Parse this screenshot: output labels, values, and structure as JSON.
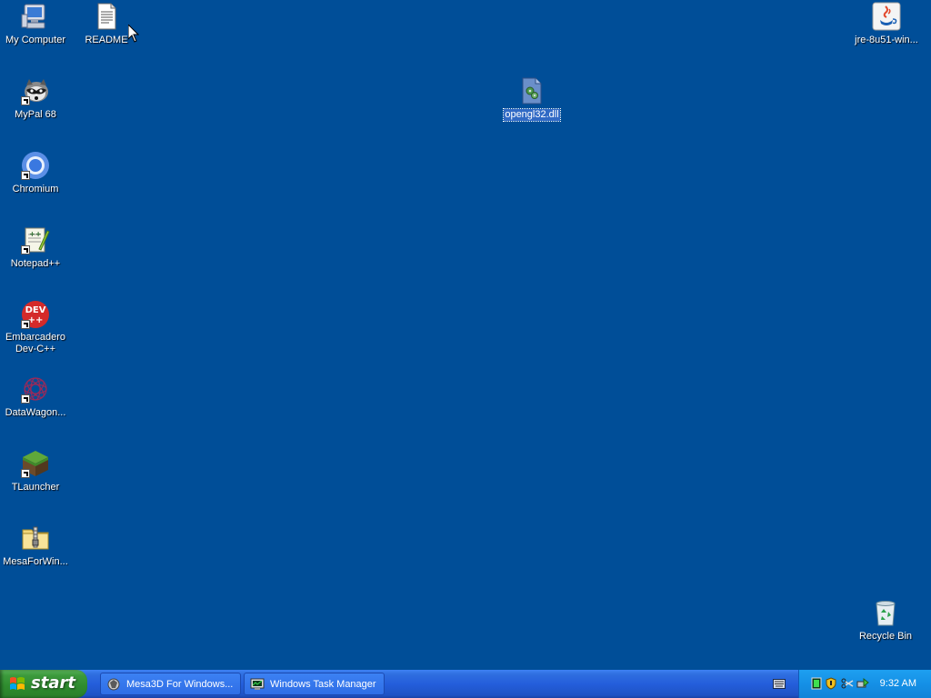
{
  "desktop": {
    "background": "#004e98",
    "icons": {
      "my_computer": "My Computer",
      "readme": "README",
      "jre": "jre-8u51-win...",
      "mypal": "MyPal 68",
      "opengl": "opengl32.dll",
      "chromium": "Chromium",
      "notepadpp": "Notepad++",
      "devcpp": "Embarcadero Dev-C++",
      "datawagon": "DataWagon...",
      "tlauncher": "TLauncher",
      "mesa_folder": "MesaForWin...",
      "recycle_bin": "Recycle Bin"
    },
    "selected_icon": "opengl32.dll"
  },
  "taskbar": {
    "start_label": "start",
    "tasks": [
      {
        "label": "Mesa3D For Windows...",
        "icon": "mesa-app-icon"
      },
      {
        "label": "Windows Task Manager",
        "icon": "task-manager-icon"
      }
    ],
    "clock": "9:32 AM"
  }
}
